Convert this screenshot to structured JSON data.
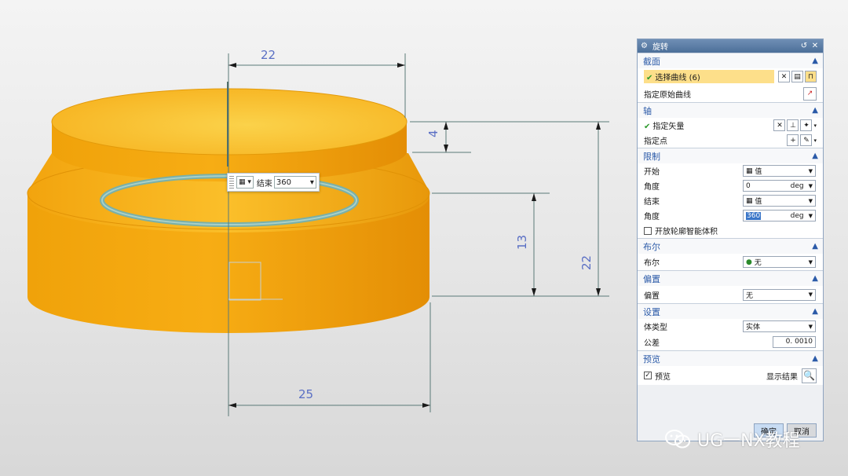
{
  "dimensions": {
    "top_width": "22",
    "step_height": "4",
    "mid_height": "13",
    "total_height": "22",
    "bottom_width": "25"
  },
  "mini_toolbar": {
    "label": "结束",
    "value": "360"
  },
  "dialog": {
    "title": "旋转",
    "sections": {
      "section": {
        "header": "截面",
        "select_curve": "选择曲线 (6)",
        "specify_origin_curve": "指定原始曲线"
      },
      "axis": {
        "header": "轴",
        "specify_vector": "指定矢量",
        "specify_point": "指定点"
      },
      "limits": {
        "header": "限制",
        "start_label": "开始",
        "start_value": "值",
        "start_angle_label": "角度",
        "start_angle_value": "0",
        "end_label": "结束",
        "end_value": "值",
        "end_angle_label": "角度",
        "end_angle_value": "360",
        "unit": "deg",
        "open_profile": "开放轮廓智能体积"
      },
      "boolean": {
        "header": "布尔",
        "label": "布尔",
        "value": "无"
      },
      "offset": {
        "header": "偏置",
        "label": "偏置",
        "value": "无"
      },
      "settings": {
        "header": "设置",
        "body_type_label": "体类型",
        "body_type_value": "实体",
        "tolerance_label": "公差",
        "tolerance_value": "0. 0010"
      },
      "preview": {
        "header": "预览",
        "preview_label": "预览",
        "show_result": "显示结果"
      }
    },
    "ok": "确定",
    "cancel": "取消"
  },
  "watermark": "UG一NX教程",
  "colors": {
    "model_orange": "#f5a30c",
    "section_header": "#2b5aa8",
    "selected_row": "#fddf8a"
  }
}
